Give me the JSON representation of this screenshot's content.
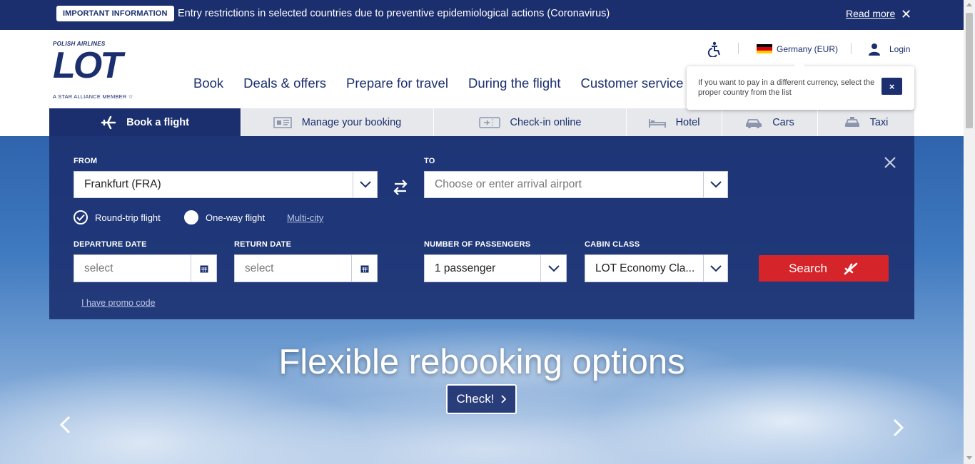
{
  "notice": {
    "badge": "IMPORTANT INFORMATION",
    "text": "Entry restrictions in selected countries due to preventive epidemiological actions (Coronavirus)",
    "link": "Read more"
  },
  "logo": {
    "top": "POLISH AIRLINES",
    "main": "LOT",
    "bottom": "A STAR ALLIANCE MEMBER"
  },
  "nav": [
    "Book",
    "Deals & offers",
    "Prepare for travel",
    "During the flight",
    "Customer service"
  ],
  "header": {
    "country": "Germany (EUR)",
    "login": "Login"
  },
  "tooltip": {
    "text": "If you want to pay in a different currency, select the proper country from the list",
    "close": "×"
  },
  "tabs": [
    {
      "label": "Book a flight",
      "icon": "plane-icon"
    },
    {
      "label": "Manage your booking",
      "icon": "ticket-icon"
    },
    {
      "label": "Check-in online",
      "icon": "boarding-pass-icon"
    },
    {
      "label": "Hotel",
      "icon": "bed-icon"
    },
    {
      "label": "Cars",
      "icon": "car-icon"
    },
    {
      "label": "Taxi",
      "icon": "taxi-icon"
    }
  ],
  "booking": {
    "from_label": "FROM",
    "from_value": "Frankfurt (FRA)",
    "to_label": "TO",
    "to_placeholder": "Choose or enter arrival airport",
    "trip_types": {
      "round_trip": "Round-trip flight",
      "one_way": "One-way flight",
      "multi_city": "Multi-city",
      "selected": "Round-trip flight"
    },
    "departure_label": "DEPARTURE DATE",
    "departure_placeholder": "select",
    "return_label": "RETURN DATE",
    "return_placeholder": "select",
    "passengers_label": "NUMBER OF PASSENGERS",
    "passengers_value": "1 passenger",
    "cabin_label": "CABIN CLASS",
    "cabin_value": "LOT Economy Cla...",
    "search": "Search",
    "promo": "I have promo code"
  },
  "hero": {
    "title": "Flexible rebooking options",
    "cta": "Check!"
  },
  "colors": {
    "brand": "#1b2f6e",
    "search": "#d6242b",
    "tab_inactive": "#e6e8ec"
  }
}
